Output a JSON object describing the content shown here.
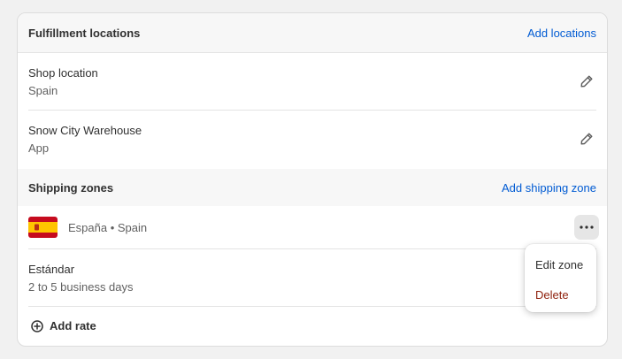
{
  "fulfillment": {
    "title": "Fulfillment locations",
    "add_link": "Add locations",
    "locations": [
      {
        "name": "Shop location",
        "detail": "Spain"
      },
      {
        "name": "Snow City Warehouse",
        "detail": "App"
      }
    ]
  },
  "shipping": {
    "title": "Shipping zones",
    "add_link": "Add shipping zone",
    "zone": {
      "name": "España • Spain",
      "flag_colors": {
        "red": "#c60b1e",
        "yellow": "#ffc400"
      }
    },
    "rate": {
      "name": "Estándar",
      "detail": "2 to 5 business days"
    },
    "add_rate_label": "Add rate"
  },
  "zone_menu": {
    "edit_label": "Edit zone",
    "delete_label": "Delete"
  },
  "colors": {
    "link": "#005bd3",
    "destructive": "#8e1f0b",
    "header_bg": "#f7f7f7"
  }
}
